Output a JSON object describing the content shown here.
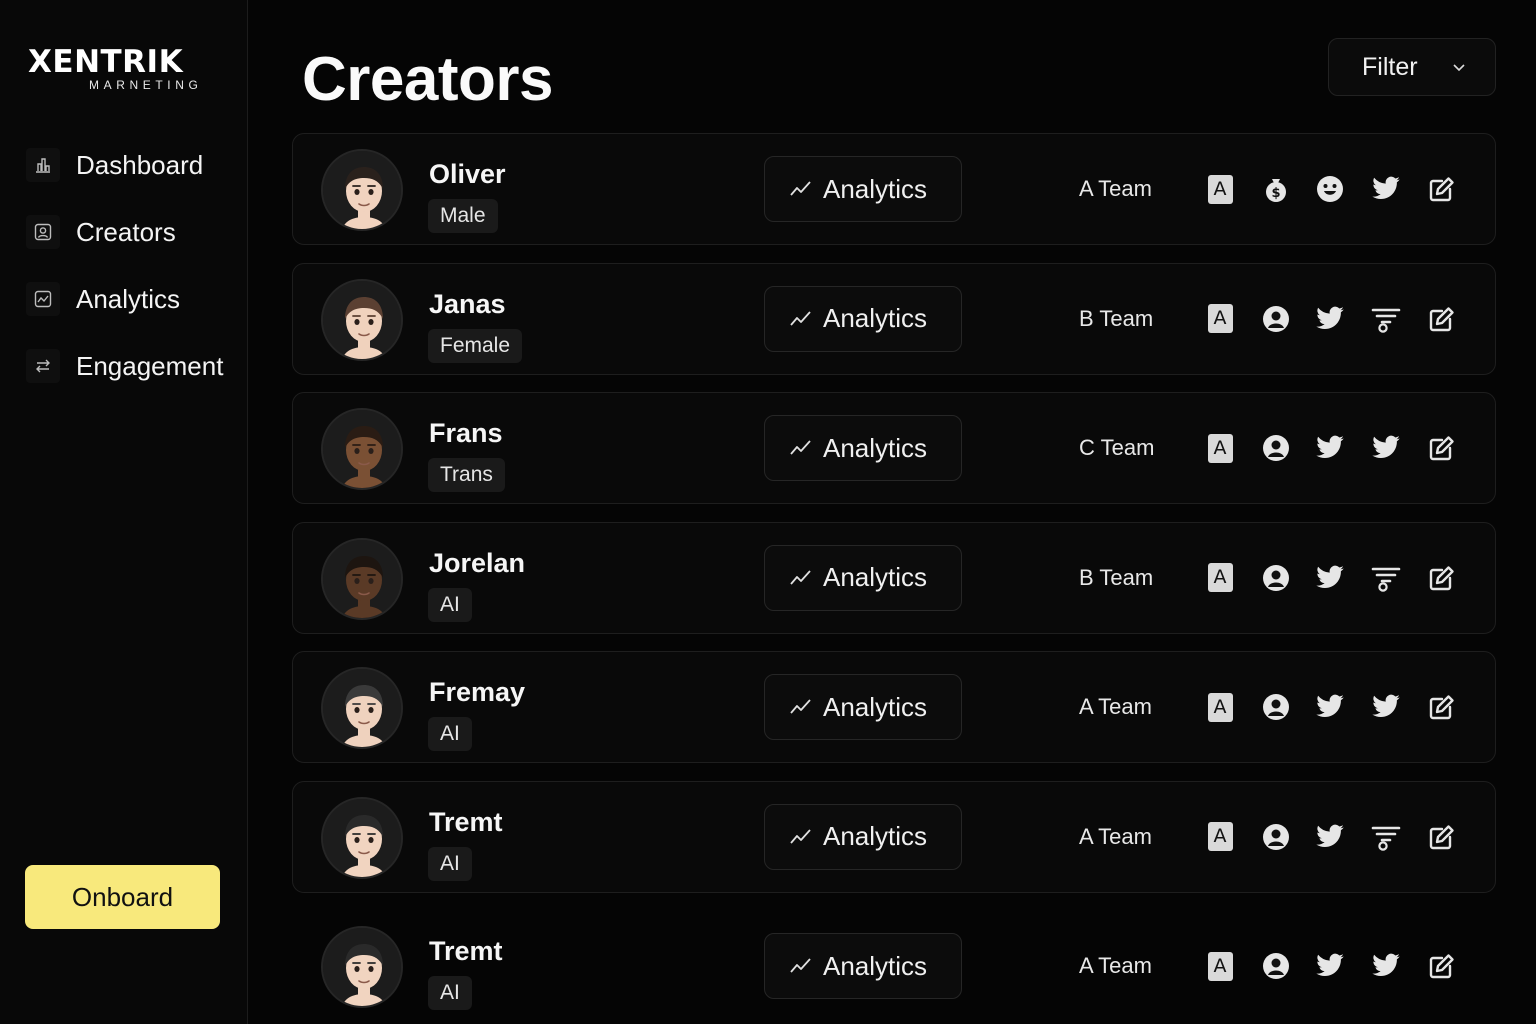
{
  "brand": {
    "name": "XENTRIK",
    "tagline": "MARNETING"
  },
  "sidebar": {
    "items": [
      {
        "label": "Dashboard",
        "icon": "bar-chart-icon"
      },
      {
        "label": "Creators",
        "icon": "user-card-icon"
      },
      {
        "label": "Analytics",
        "icon": "line-chart-icon"
      },
      {
        "label": "Engagement",
        "icon": "swap-arrows-icon"
      }
    ],
    "onboard_label": "Onboard"
  },
  "main": {
    "title": "Creators",
    "filter_label": "Filter",
    "analytics_label": "Analytics",
    "creators": [
      {
        "name": "Oliver",
        "tag": "Male",
        "team": "A Team",
        "icons": [
          "app-store-icon",
          "coin-bag-icon",
          "smiley-icon",
          "twitter-icon",
          "edit-icon"
        ]
      },
      {
        "name": "Janas",
        "tag": "Female",
        "team": "B Team",
        "icons": [
          "app-store-icon",
          "profile-icon",
          "twitter-icon",
          "funnel-icon",
          "edit-icon"
        ]
      },
      {
        "name": "Frans",
        "tag": "Trans",
        "team": "C Team",
        "icons": [
          "app-store-icon",
          "profile-icon",
          "twitter-icon",
          "twitter-icon",
          "edit-icon"
        ]
      },
      {
        "name": "Jorelan",
        "tag": "AI",
        "team": "B Team",
        "icons": [
          "app-store-icon",
          "profile-icon",
          "twitter-icon",
          "funnel-icon",
          "edit-icon"
        ]
      },
      {
        "name": "Fremay",
        "tag": "AI",
        "team": "A Team",
        "icons": [
          "app-store-icon",
          "profile-icon",
          "twitter-icon",
          "twitter-icon",
          "edit-icon"
        ]
      },
      {
        "name": "Tremt",
        "tag": "AI",
        "team": "A Team",
        "icons": [
          "app-store-icon",
          "profile-icon",
          "twitter-icon",
          "funnel-icon",
          "edit-icon"
        ]
      },
      {
        "name": "Tremt",
        "tag": "AI",
        "team": "A Team",
        "icons": [
          "app-store-icon",
          "profile-icon",
          "twitter-icon",
          "twitter-icon",
          "edit-icon"
        ]
      }
    ]
  },
  "colors": {
    "background": "#050505",
    "accent": "#f8e97c",
    "card": "#090909",
    "skin_tones": [
      "#f1d3bf",
      "#f0d2bd",
      "#7a5034",
      "#5a3a26",
      "#efd2be",
      "#f1d4c0",
      "#f1d4c0"
    ],
    "hair_colors": [
      "#2a211c",
      "#5b4032",
      "#2a1c14",
      "#1d1510",
      "#3a3a3a",
      "#2a2a2a",
      "#2a2a2a"
    ]
  }
}
